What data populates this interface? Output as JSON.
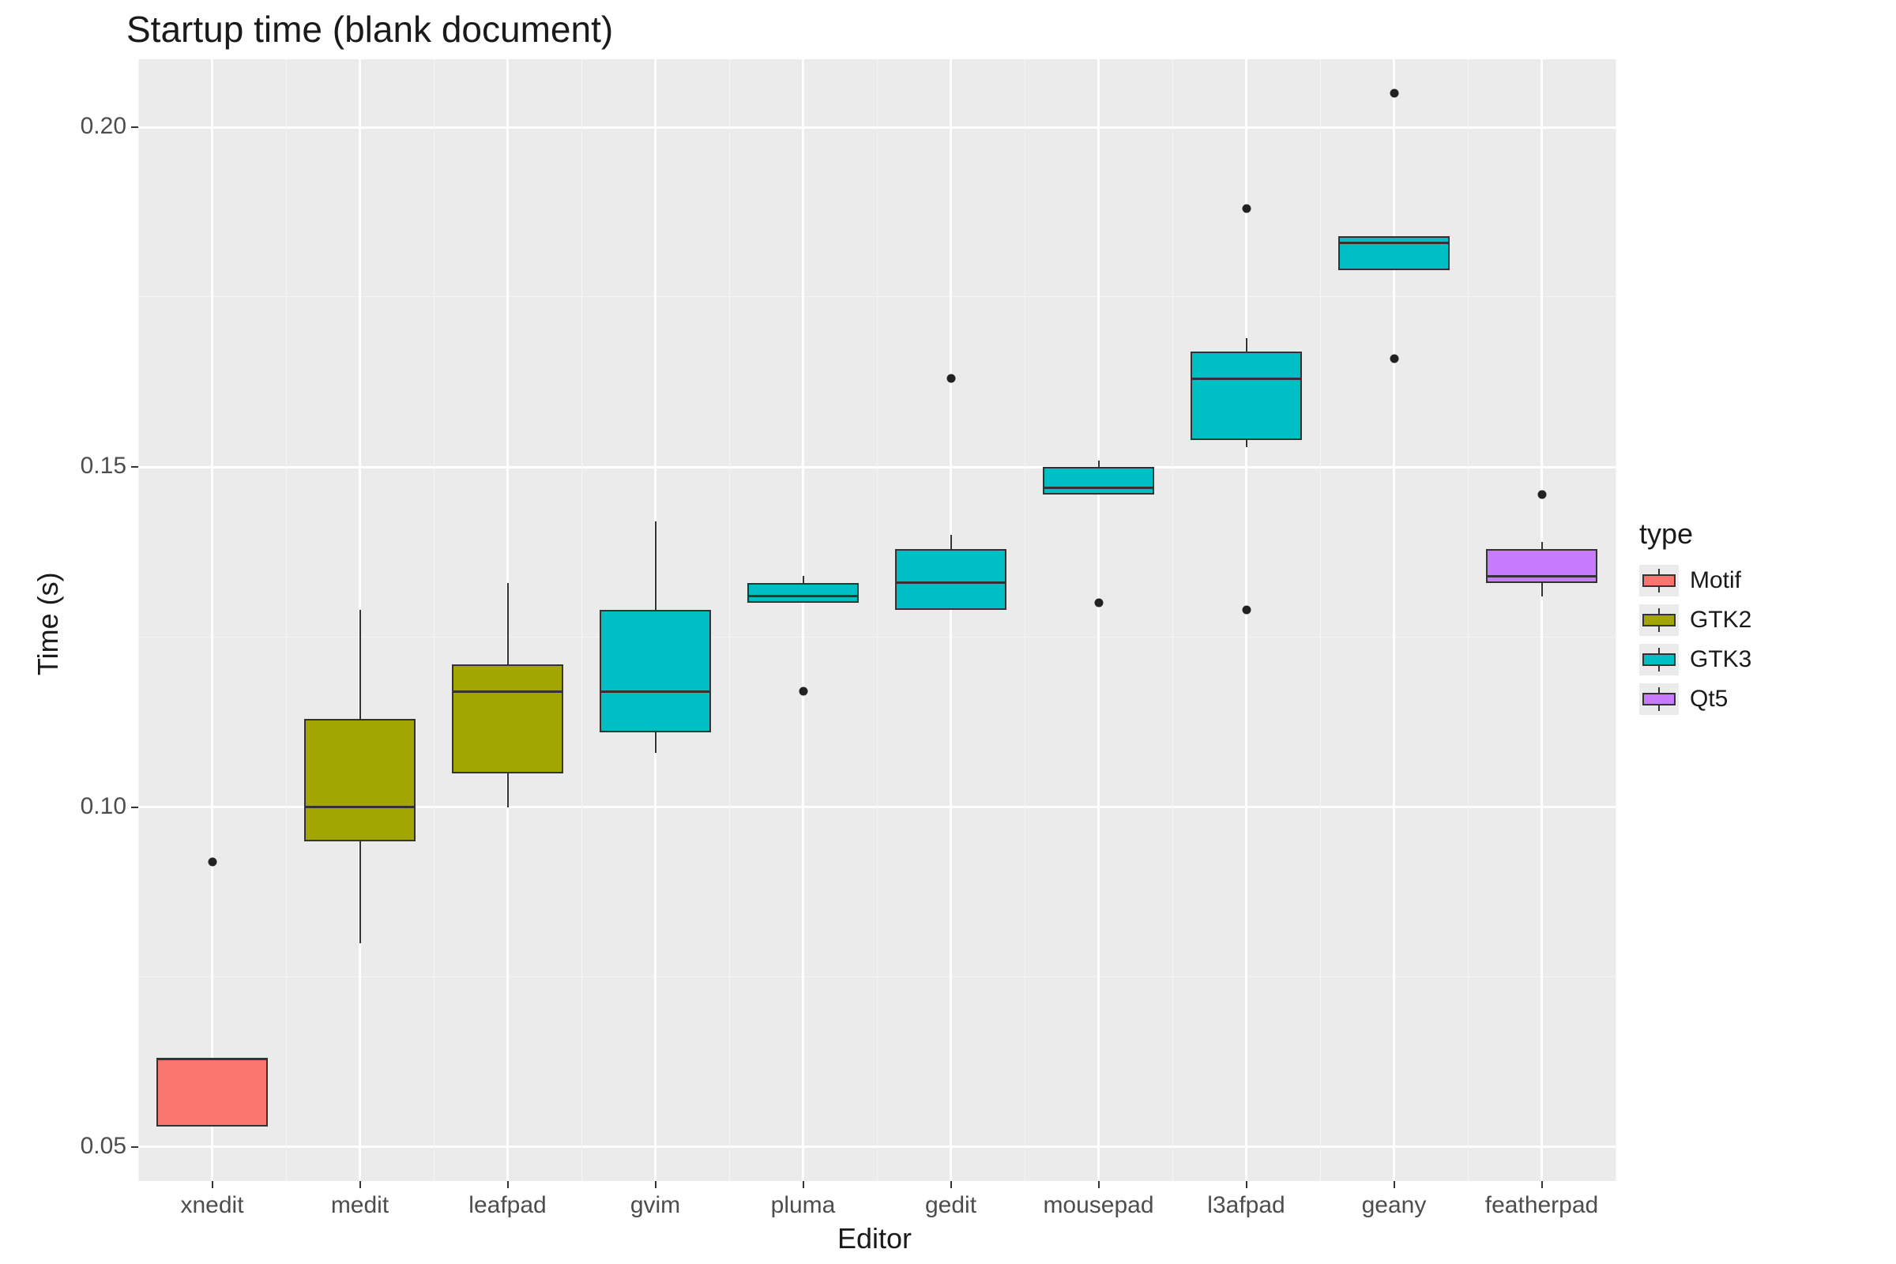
{
  "chart_data": {
    "type": "boxplot",
    "title": "Startup time (blank document)",
    "xlabel": "Editor",
    "ylabel": "Time (s)",
    "ylim": [
      0.045,
      0.21
    ],
    "y_ticks": [
      0.05,
      0.1,
      0.15,
      0.2
    ],
    "categories": [
      "xnedit",
      "medit",
      "leafpad",
      "gvim",
      "pluma",
      "gedit",
      "mousepad",
      "l3afpad",
      "geany",
      "featherpad"
    ],
    "legend_title": "type",
    "legend": [
      {
        "name": "Motif",
        "color": "#F8766D"
      },
      {
        "name": "GTK2",
        "color": "#A3A500"
      },
      {
        "name": "GTK3",
        "color": "#00BFC4"
      },
      {
        "name": "Qt5",
        "color": "#C77CFF"
      }
    ],
    "series": [
      {
        "name": "xnedit",
        "type": "Motif",
        "color": "#F8766D",
        "lower_whisker": 0.053,
        "q1": 0.053,
        "median": 0.063,
        "q3": 0.063,
        "upper_whisker": 0.063,
        "outliers": [
          0.092
        ]
      },
      {
        "name": "medit",
        "type": "GTK2",
        "color": "#A3A500",
        "lower_whisker": 0.08,
        "q1": 0.095,
        "median": 0.1,
        "q3": 0.113,
        "upper_whisker": 0.129,
        "outliers": []
      },
      {
        "name": "leafpad",
        "type": "GTK2",
        "color": "#A3A500",
        "lower_whisker": 0.1,
        "q1": 0.105,
        "median": 0.117,
        "q3": 0.121,
        "upper_whisker": 0.133,
        "outliers": []
      },
      {
        "name": "gvim",
        "type": "GTK3",
        "color": "#00BFC4",
        "lower_whisker": 0.108,
        "q1": 0.111,
        "median": 0.117,
        "q3": 0.129,
        "upper_whisker": 0.142,
        "outliers": []
      },
      {
        "name": "pluma",
        "type": "GTK3",
        "color": "#00BFC4",
        "lower_whisker": 0.13,
        "q1": 0.13,
        "median": 0.131,
        "q3": 0.133,
        "upper_whisker": 0.134,
        "outliers": [
          0.117
        ]
      },
      {
        "name": "gedit",
        "type": "GTK3",
        "color": "#00BFC4",
        "lower_whisker": 0.129,
        "q1": 0.129,
        "median": 0.133,
        "q3": 0.138,
        "upper_whisker": 0.14,
        "outliers": [
          0.163
        ]
      },
      {
        "name": "mousepad",
        "type": "GTK3",
        "color": "#00BFC4",
        "lower_whisker": 0.146,
        "q1": 0.146,
        "median": 0.147,
        "q3": 0.15,
        "upper_whisker": 0.151,
        "outliers": [
          0.13
        ]
      },
      {
        "name": "l3afpad",
        "type": "GTK3",
        "color": "#00BFC4",
        "lower_whisker": 0.153,
        "q1": 0.154,
        "median": 0.163,
        "q3": 0.167,
        "upper_whisker": 0.169,
        "outliers": [
          0.129,
          0.188
        ]
      },
      {
        "name": "geany",
        "type": "GTK3",
        "color": "#00BFC4",
        "lower_whisker": 0.179,
        "q1": 0.179,
        "median": 0.183,
        "q3": 0.184,
        "upper_whisker": 0.184,
        "outliers": [
          0.166,
          0.205
        ]
      },
      {
        "name": "featherpad",
        "type": "Qt5",
        "color": "#C77CFF",
        "lower_whisker": 0.131,
        "q1": 0.133,
        "median": 0.134,
        "q3": 0.138,
        "upper_whisker": 0.139,
        "outliers": [
          0.146
        ]
      }
    ]
  },
  "labels": {
    "y_ticks": [
      "0.05",
      "0.10",
      "0.15",
      "0.20"
    ]
  }
}
